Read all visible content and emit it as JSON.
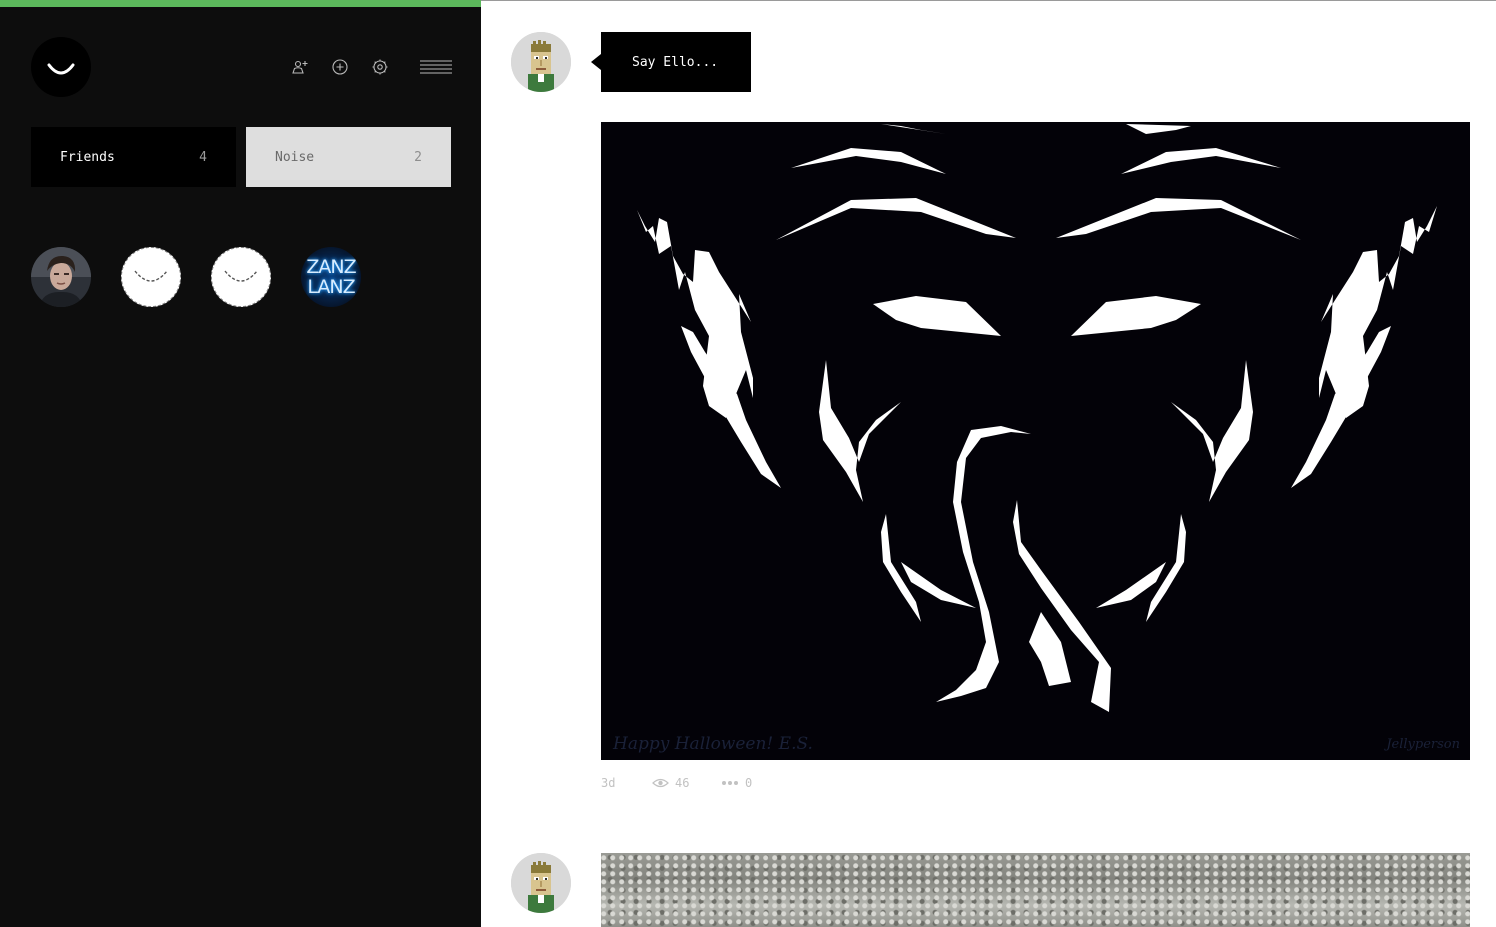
{
  "app": {
    "progress_percent": 100,
    "accent_color": "#5cb85c"
  },
  "sidebar": {
    "logo_icon": "ello-smile-icon",
    "toolbar": [
      {
        "icon": "invite-person-icon"
      },
      {
        "icon": "add-circle-icon"
      },
      {
        "icon": "gear-icon"
      },
      {
        "icon": "menu-icon"
      }
    ],
    "tabs": [
      {
        "label": "Friends",
        "count": "4",
        "active": true
      },
      {
        "label": "Noise",
        "count": "2",
        "active": false
      }
    ],
    "friends": [
      {
        "kind": "photo",
        "icon": "person-photo-avatar"
      },
      {
        "kind": "default",
        "icon": "ello-default-avatar"
      },
      {
        "kind": "default",
        "icon": "ello-default-avatar"
      },
      {
        "kind": "text",
        "line1": "ZANZ",
        "line2": "LANZ"
      }
    ]
  },
  "composer": {
    "avatar_icon": "pixel-portrait-avatar",
    "placeholder": "Say Ello..."
  },
  "posts": [
    {
      "image_icon": "elephant-line-art",
      "signature": "Happy Halloween! E.S.",
      "signature_right": "Jellyperson",
      "age": "3d",
      "views": "46",
      "comments": "0"
    },
    {
      "image_icon": "gravel-photo"
    }
  ]
}
